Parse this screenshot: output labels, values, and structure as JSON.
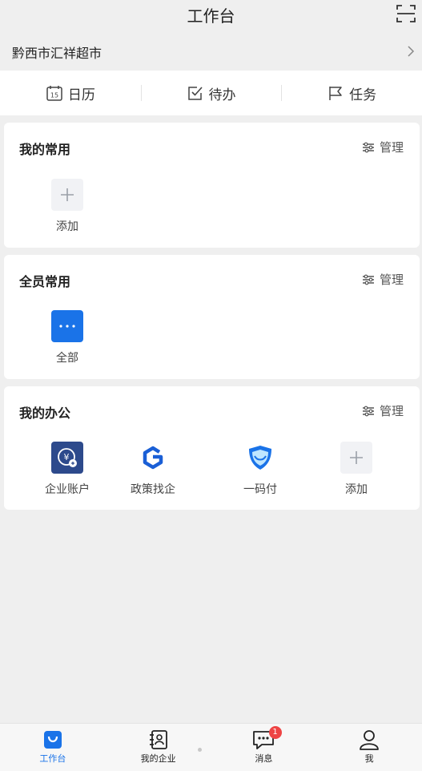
{
  "header": {
    "title": "工作台"
  },
  "store": {
    "name": "黔西市汇祥超市"
  },
  "quick": [
    {
      "label": "日历",
      "icon": "calendar-icon",
      "icon_text": "15"
    },
    {
      "label": "待办",
      "icon": "check-square-icon"
    },
    {
      "label": "任务",
      "icon": "flag-icon"
    }
  ],
  "my_common": {
    "title": "我的常用",
    "manage": "管理",
    "tiles": [
      {
        "label": "添加",
        "icon": "plus-icon"
      }
    ]
  },
  "all_common": {
    "title": "全员常用",
    "manage": "管理",
    "tiles": [
      {
        "label": "全部",
        "icon": "more-dots-icon"
      }
    ]
  },
  "my_office": {
    "title": "我的办公",
    "manage": "管理",
    "tiles": [
      {
        "label": "企业账户",
        "icon": "enterprise-account-icon"
      },
      {
        "label": "政策找企",
        "icon": "policy-g-icon"
      },
      {
        "label": "一码付",
        "icon": "shield-pay-icon"
      },
      {
        "label": "添加",
        "icon": "plus-icon"
      }
    ]
  },
  "tabbar": {
    "items": [
      {
        "label": "工作台",
        "icon": "workbench-icon",
        "active": true
      },
      {
        "label": "我的企业",
        "icon": "contacts-book-icon"
      },
      {
        "label": "消息",
        "icon": "message-icon",
        "badge": "1"
      },
      {
        "label": "我",
        "icon": "person-icon"
      }
    ]
  },
  "colors": {
    "accent": "#1a73e8",
    "badge": "#ee4444",
    "background": "#efefef"
  }
}
